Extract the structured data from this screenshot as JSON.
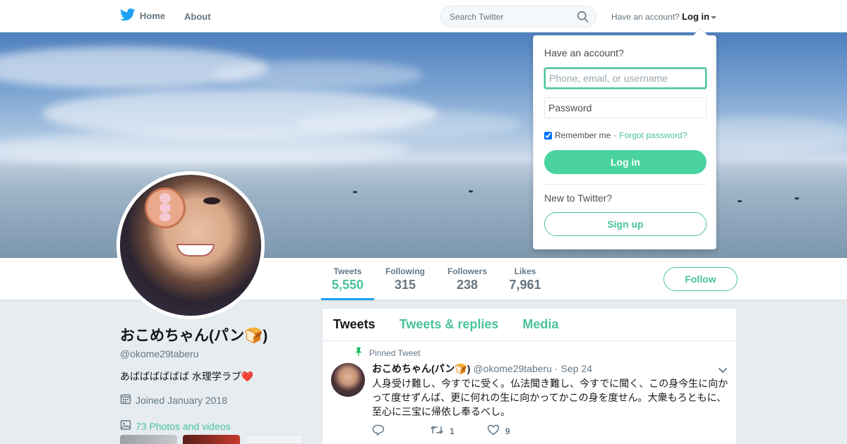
{
  "topbar": {
    "home_label": "Home",
    "about_label": "About",
    "search_placeholder": "Search Twitter",
    "have_account_text": "Have an account?",
    "login_label": "Log in"
  },
  "login_dropdown": {
    "title": "Have an account?",
    "username_placeholder": "Phone, email, or username",
    "password_placeholder": "Password",
    "remember_label": "Remember me",
    "separator": "·",
    "forgot_label": "Forgot password?",
    "login_button": "Log in",
    "new_to_label": "New to Twitter?",
    "signup_button": "Sign up",
    "remember_checked": true
  },
  "stats": [
    {
      "label": "Tweets",
      "value": "5,550",
      "active": true
    },
    {
      "label": "Following",
      "value": "315"
    },
    {
      "label": "Followers",
      "value": "238"
    },
    {
      "label": "Likes",
      "value": "7,961"
    }
  ],
  "follow_button": "Follow",
  "profile": {
    "display_name": "おこめちゃん(パン🍞)",
    "handle": "@okome29taberu",
    "bio": "あばばばばばば 水理学ラブ❤️",
    "joined": "Joined January 2018",
    "photos_link": "73 Photos and videos"
  },
  "timeline": {
    "tabs": [
      {
        "label": "Tweets",
        "active": true
      },
      {
        "label": "Tweets & replies"
      },
      {
        "label": "Media"
      }
    ],
    "tweet": {
      "pinned_label": "Pinned Tweet",
      "name": "おこめちゃん(パン🍞)",
      "handle": "@okome29taberu",
      "dot": "·",
      "date": "Sep 24",
      "text": "人身受け難し、今すでに受く。仏法聞き難し、今すでに聞く、この身今生に向かって度せずんば、更に何れの生に向かってかこの身を度せん。大衆もろともに、至心に三宝に帰依し奉るべし。",
      "retweets": "1",
      "likes": "9"
    }
  },
  "colors": {
    "accent": "#4ac29b",
    "twitter_blue": "#1da1f2",
    "text_muted": "#657786"
  },
  "icons": [
    "twitter-bird-icon",
    "search-icon",
    "caret-down-icon",
    "calendar-icon",
    "image-icon",
    "pin-icon",
    "chevron-down-icon",
    "reply-icon",
    "retweet-icon",
    "heart-icon"
  ]
}
